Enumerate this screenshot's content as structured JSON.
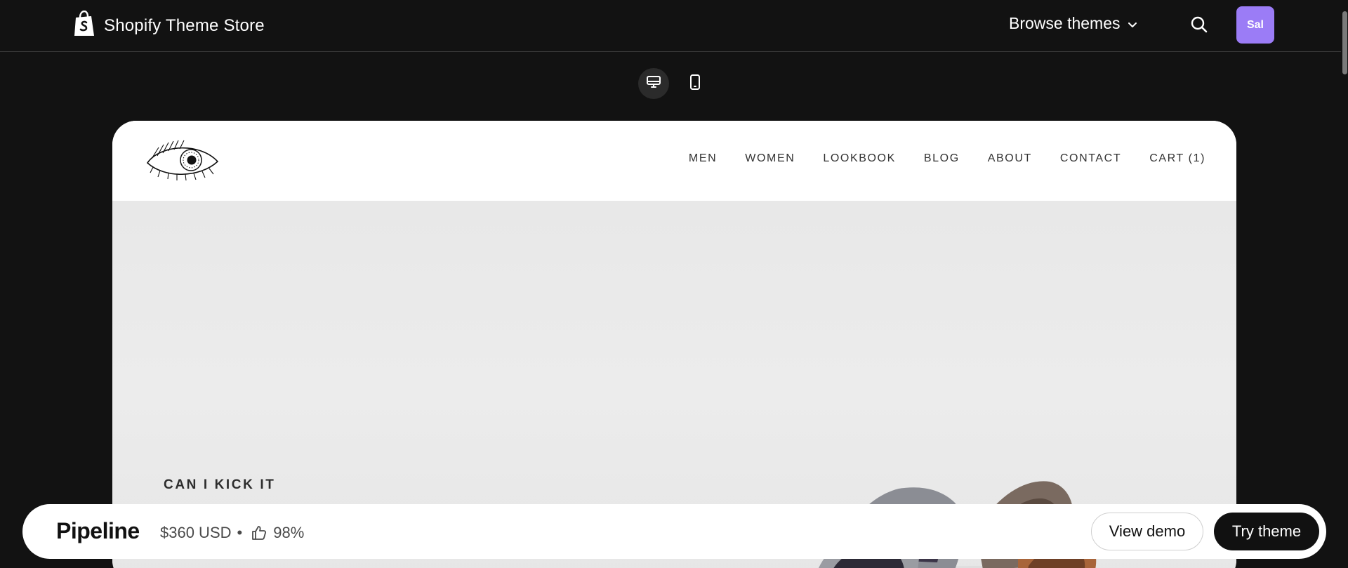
{
  "topbar": {
    "brand_icon": "shopify-bag-icon",
    "brand_title": "Shopify Theme Store",
    "browse_label": "Browse themes",
    "search_icon": "search-icon",
    "avatar_initials": "Sal",
    "avatar_color": "#9b7cf6"
  },
  "view_toggle": {
    "desktop_icon": "desktop-icon",
    "mobile_icon": "mobile-icon",
    "active": "desktop"
  },
  "preview": {
    "logo_icon": "eye-logo-icon",
    "nav": [
      "MEN",
      "WOMEN",
      "LOOKBOOK",
      "BLOG",
      "ABOUT",
      "CONTACT",
      "CART (1)"
    ],
    "hero_kicker": "CAN I KICK IT"
  },
  "bottombar": {
    "theme_name": "Pipeline",
    "price": "$360 USD",
    "separator": "•",
    "rating_icon": "thumbs-up-icon",
    "rating": "98%",
    "view_demo_label": "View demo",
    "try_theme_label": "Try theme"
  },
  "colors": {
    "background": "#121212",
    "accent": "#9b7cf6",
    "primary_button": "#111111"
  }
}
